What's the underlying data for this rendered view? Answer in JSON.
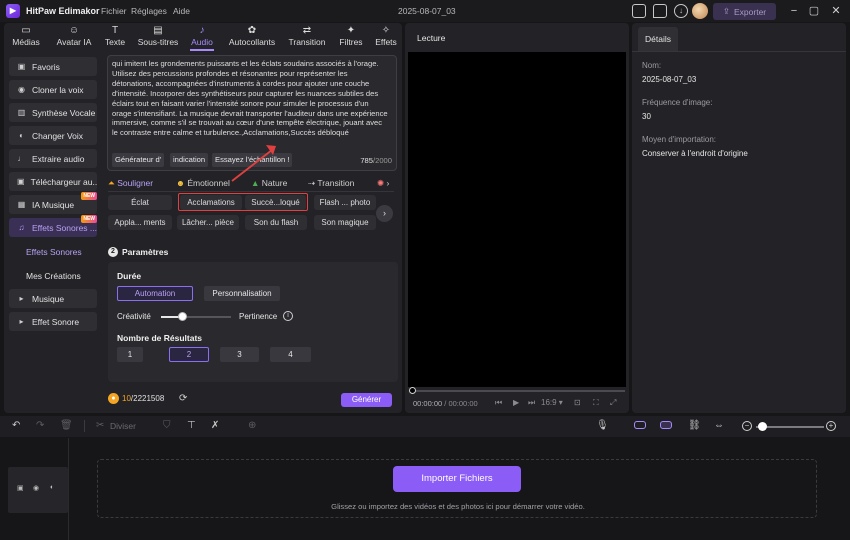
{
  "titlebar": {
    "app_name": "HitPaw Edimakor",
    "menus": [
      "Fichier",
      "Réglages",
      "Aide"
    ],
    "project_name": "2025-08-07_03",
    "export_label": "Exporter"
  },
  "tabs": [
    {
      "label": "Médias",
      "icon": "folder-icon"
    },
    {
      "label": "Avatar IA",
      "icon": "avatar-icon"
    },
    {
      "label": "Texte",
      "icon": "text-icon"
    },
    {
      "label": "Sous-titres",
      "icon": "subtitle-icon"
    },
    {
      "label": "Audio",
      "icon": "music-icon",
      "active": true
    },
    {
      "label": "Autocollants",
      "icon": "sticker-icon"
    },
    {
      "label": "Transition",
      "icon": "transition-icon"
    },
    {
      "label": "Filtres",
      "icon": "filter-icon"
    },
    {
      "label": "Effets",
      "icon": "effects-icon"
    }
  ],
  "sidebar": {
    "items": [
      {
        "label": "Favoris"
      },
      {
        "label": "Cloner la voix"
      },
      {
        "label": "Synthèse Vocale"
      },
      {
        "label": "Changer Voix"
      },
      {
        "label": "Extraire audio"
      },
      {
        "label": "Téléchargeur au..."
      },
      {
        "label": "IA Musique",
        "badge": "NEW"
      },
      {
        "label": "Effets Sonores ...",
        "badge": "NEW",
        "active": true
      },
      {
        "label": "Musique"
      },
      {
        "label": "Effet Sonore"
      }
    ],
    "subitems": [
      {
        "label": "Effets Sonores",
        "active": true
      },
      {
        "label": "Mes Créations"
      }
    ]
  },
  "prompt": {
    "text": "qui imitent les grondements puissants et les éclats soudains associés à l'orage. Utilisez des percussions profondes et résonantes pour représenter les détonations, accompagnées d'instruments à cordes pour ajouter une couche d'intensité. Incorporer des synthétiseurs pour capturer les nuances subtiles des éclairs tout en faisant varier l'intensité sonore pour simuler le processus d'un orage s'intensifiant. La musique devrait transporter l'auditeur dans une expérience immersive, comme s'il se trouvait au cœur d'une tempête électrique, jouant avec le contraste entre calme et turbulence.,Acclamations,Succès débloqué",
    "chips": [
      "Générateur d'",
      "indication",
      "Essayez l'échantillon !"
    ],
    "char_count": "785",
    "char_max": "/2000"
  },
  "categories": [
    {
      "label": "Souligner",
      "icon": "bell-icon",
      "active": true
    },
    {
      "label": "Émotionnel",
      "icon": "smile-icon"
    },
    {
      "label": "Nature",
      "icon": "tree-icon"
    },
    {
      "label": "Transition",
      "icon": "transition-icon"
    },
    {
      "label": "",
      "icon": "more-icon"
    }
  ],
  "sound_chips": {
    "row1": [
      "Éclat",
      "Acclamations",
      "Succè...loqué",
      "Flash ... photo"
    ],
    "row2": [
      "Appla... ments",
      "Lâcher... pièce",
      "Son du flash",
      "Son magique"
    ]
  },
  "params": {
    "section_number": "2",
    "section_title": "Paramètres",
    "duration_label": "Durée",
    "duration_options": [
      "Automation",
      "Personnalisation"
    ],
    "creativity_label": "Créativité",
    "relevance_label": "Pertinence",
    "creativity_value": 0.3,
    "results_label": "Nombre de Résultats",
    "results_options": [
      "1",
      "2",
      "3",
      "4"
    ],
    "results_selected": "2"
  },
  "credits": {
    "used": "10",
    "total": "/2221508",
    "generate_label": "Générer"
  },
  "preview": {
    "title": "Lecture",
    "time_current": "00:00:00",
    "time_total": "/ 00:00:00",
    "aspect": "16:9"
  },
  "details": {
    "tab": "Détails",
    "name_label": "Nom:",
    "name_value": "2025-08-07_03",
    "fps_label": "Fréquence d'image:",
    "fps_value": "30",
    "import_label": "Moyen d'importation:",
    "import_value": "Conserver à l'endroit d'origine"
  },
  "timeline": {
    "divide_label": "Diviser",
    "import_button": "Importer Fichiers",
    "hint": "Glissez ou importez des vidéos et des photos ici pour démarrer votre vidéo."
  },
  "colors": {
    "accent": "#8b5cf6",
    "annotation": "#e0403f"
  }
}
